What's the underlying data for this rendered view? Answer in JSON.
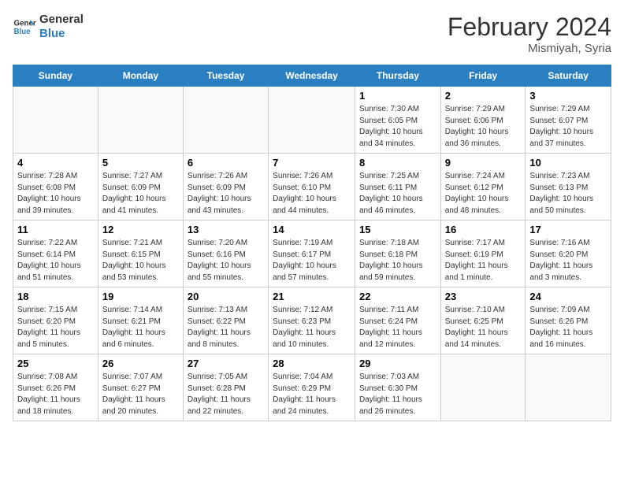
{
  "header": {
    "logo_line1": "General",
    "logo_line2": "Blue",
    "month_year": "February 2024",
    "location": "Mismiyah, Syria"
  },
  "days_of_week": [
    "Sunday",
    "Monday",
    "Tuesday",
    "Wednesday",
    "Thursday",
    "Friday",
    "Saturday"
  ],
  "weeks": [
    [
      {
        "day": "",
        "info": ""
      },
      {
        "day": "",
        "info": ""
      },
      {
        "day": "",
        "info": ""
      },
      {
        "day": "",
        "info": ""
      },
      {
        "day": "1",
        "info": "Sunrise: 7:30 AM\nSunset: 6:05 PM\nDaylight: 10 hours\nand 34 minutes."
      },
      {
        "day": "2",
        "info": "Sunrise: 7:29 AM\nSunset: 6:06 PM\nDaylight: 10 hours\nand 36 minutes."
      },
      {
        "day": "3",
        "info": "Sunrise: 7:29 AM\nSunset: 6:07 PM\nDaylight: 10 hours\nand 37 minutes."
      }
    ],
    [
      {
        "day": "4",
        "info": "Sunrise: 7:28 AM\nSunset: 6:08 PM\nDaylight: 10 hours\nand 39 minutes."
      },
      {
        "day": "5",
        "info": "Sunrise: 7:27 AM\nSunset: 6:09 PM\nDaylight: 10 hours\nand 41 minutes."
      },
      {
        "day": "6",
        "info": "Sunrise: 7:26 AM\nSunset: 6:09 PM\nDaylight: 10 hours\nand 43 minutes."
      },
      {
        "day": "7",
        "info": "Sunrise: 7:26 AM\nSunset: 6:10 PM\nDaylight: 10 hours\nand 44 minutes."
      },
      {
        "day": "8",
        "info": "Sunrise: 7:25 AM\nSunset: 6:11 PM\nDaylight: 10 hours\nand 46 minutes."
      },
      {
        "day": "9",
        "info": "Sunrise: 7:24 AM\nSunset: 6:12 PM\nDaylight: 10 hours\nand 48 minutes."
      },
      {
        "day": "10",
        "info": "Sunrise: 7:23 AM\nSunset: 6:13 PM\nDaylight: 10 hours\nand 50 minutes."
      }
    ],
    [
      {
        "day": "11",
        "info": "Sunrise: 7:22 AM\nSunset: 6:14 PM\nDaylight: 10 hours\nand 51 minutes."
      },
      {
        "day": "12",
        "info": "Sunrise: 7:21 AM\nSunset: 6:15 PM\nDaylight: 10 hours\nand 53 minutes."
      },
      {
        "day": "13",
        "info": "Sunrise: 7:20 AM\nSunset: 6:16 PM\nDaylight: 10 hours\nand 55 minutes."
      },
      {
        "day": "14",
        "info": "Sunrise: 7:19 AM\nSunset: 6:17 PM\nDaylight: 10 hours\nand 57 minutes."
      },
      {
        "day": "15",
        "info": "Sunrise: 7:18 AM\nSunset: 6:18 PM\nDaylight: 10 hours\nand 59 minutes."
      },
      {
        "day": "16",
        "info": "Sunrise: 7:17 AM\nSunset: 6:19 PM\nDaylight: 11 hours\nand 1 minute."
      },
      {
        "day": "17",
        "info": "Sunrise: 7:16 AM\nSunset: 6:20 PM\nDaylight: 11 hours\nand 3 minutes."
      }
    ],
    [
      {
        "day": "18",
        "info": "Sunrise: 7:15 AM\nSunset: 6:20 PM\nDaylight: 11 hours\nand 5 minutes."
      },
      {
        "day": "19",
        "info": "Sunrise: 7:14 AM\nSunset: 6:21 PM\nDaylight: 11 hours\nand 6 minutes."
      },
      {
        "day": "20",
        "info": "Sunrise: 7:13 AM\nSunset: 6:22 PM\nDaylight: 11 hours\nand 8 minutes."
      },
      {
        "day": "21",
        "info": "Sunrise: 7:12 AM\nSunset: 6:23 PM\nDaylight: 11 hours\nand 10 minutes."
      },
      {
        "day": "22",
        "info": "Sunrise: 7:11 AM\nSunset: 6:24 PM\nDaylight: 11 hours\nand 12 minutes."
      },
      {
        "day": "23",
        "info": "Sunrise: 7:10 AM\nSunset: 6:25 PM\nDaylight: 11 hours\nand 14 minutes."
      },
      {
        "day": "24",
        "info": "Sunrise: 7:09 AM\nSunset: 6:26 PM\nDaylight: 11 hours\nand 16 minutes."
      }
    ],
    [
      {
        "day": "25",
        "info": "Sunrise: 7:08 AM\nSunset: 6:26 PM\nDaylight: 11 hours\nand 18 minutes."
      },
      {
        "day": "26",
        "info": "Sunrise: 7:07 AM\nSunset: 6:27 PM\nDaylight: 11 hours\nand 20 minutes."
      },
      {
        "day": "27",
        "info": "Sunrise: 7:05 AM\nSunset: 6:28 PM\nDaylight: 11 hours\nand 22 minutes."
      },
      {
        "day": "28",
        "info": "Sunrise: 7:04 AM\nSunset: 6:29 PM\nDaylight: 11 hours\nand 24 minutes."
      },
      {
        "day": "29",
        "info": "Sunrise: 7:03 AM\nSunset: 6:30 PM\nDaylight: 11 hours\nand 26 minutes."
      },
      {
        "day": "",
        "info": ""
      },
      {
        "day": "",
        "info": ""
      }
    ]
  ]
}
